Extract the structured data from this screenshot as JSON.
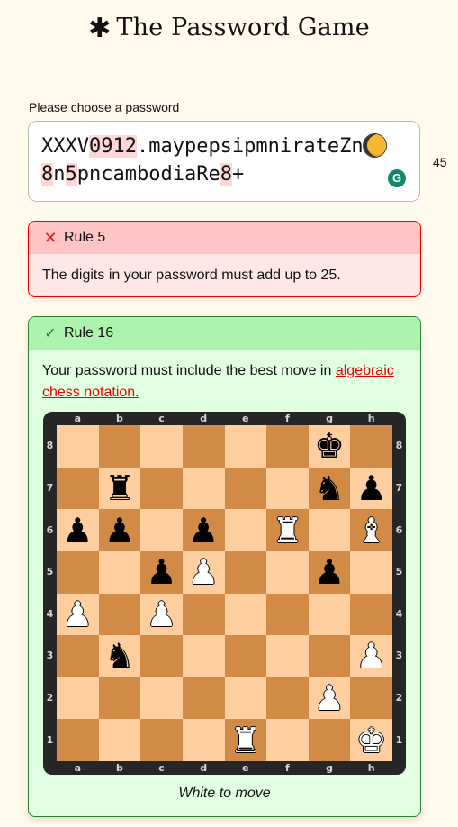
{
  "header": {
    "icon": "asterisk-icon",
    "title": "The Password Game"
  },
  "password": {
    "label": "Please choose a password",
    "segments": [
      {
        "text": "XXXV",
        "hl": false
      },
      {
        "text": "0912",
        "hl": true
      },
      {
        "text": ".maypepsipmnirateZn",
        "hl": false
      },
      {
        "emoji": "waning-gibbous-moon"
      },
      {
        "text": "8",
        "hl": true
      },
      {
        "text": "n",
        "hl": false
      },
      {
        "text": "5",
        "hl": true
      },
      {
        "text": "pncambodiaRe",
        "hl": false
      },
      {
        "text": "8",
        "hl": true
      },
      {
        "text": "+",
        "hl": false
      }
    ],
    "char_count": "45",
    "grammarly_icon": "G"
  },
  "rules": [
    {
      "number_label": "Rule 5",
      "status": "fail",
      "status_icon": "✕",
      "text": "The digits in your password must add up to 25."
    },
    {
      "number_label": "Rule 16",
      "status": "pass",
      "status_icon": "✓",
      "text": "Your password must include the best move in ",
      "link_text": "algebraic chess notation.",
      "caption": "White to move"
    }
  ],
  "chess": {
    "files": [
      "a",
      "b",
      "c",
      "d",
      "e",
      "f",
      "g",
      "h"
    ],
    "ranks": [
      "8",
      "7",
      "6",
      "5",
      "4",
      "3",
      "2",
      "1"
    ],
    "colors": {
      "light": "#ffce9e",
      "dark": "#d18b47",
      "frame": "#262626"
    },
    "pieces": [
      {
        "square": "g8",
        "piece": "king",
        "color": "black"
      },
      {
        "square": "b7",
        "piece": "rook",
        "color": "black"
      },
      {
        "square": "g7",
        "piece": "knight",
        "color": "black"
      },
      {
        "square": "h7",
        "piece": "pawn",
        "color": "black"
      },
      {
        "square": "a6",
        "piece": "pawn",
        "color": "black"
      },
      {
        "square": "b6",
        "piece": "pawn",
        "color": "black"
      },
      {
        "square": "d6",
        "piece": "pawn",
        "color": "black"
      },
      {
        "square": "f6",
        "piece": "rook",
        "color": "white"
      },
      {
        "square": "h6",
        "piece": "bishop",
        "color": "white"
      },
      {
        "square": "c5",
        "piece": "pawn",
        "color": "black"
      },
      {
        "square": "d5",
        "piece": "pawn",
        "color": "white"
      },
      {
        "square": "g5",
        "piece": "pawn",
        "color": "black"
      },
      {
        "square": "a4",
        "piece": "pawn",
        "color": "white"
      },
      {
        "square": "c4",
        "piece": "pawn",
        "color": "white"
      },
      {
        "square": "b3",
        "piece": "knight",
        "color": "black"
      },
      {
        "square": "h3",
        "piece": "pawn",
        "color": "white"
      },
      {
        "square": "g2",
        "piece": "pawn",
        "color": "white"
      },
      {
        "square": "e1",
        "piece": "rook",
        "color": "white"
      },
      {
        "square": "h1",
        "piece": "king",
        "color": "white"
      }
    ]
  }
}
